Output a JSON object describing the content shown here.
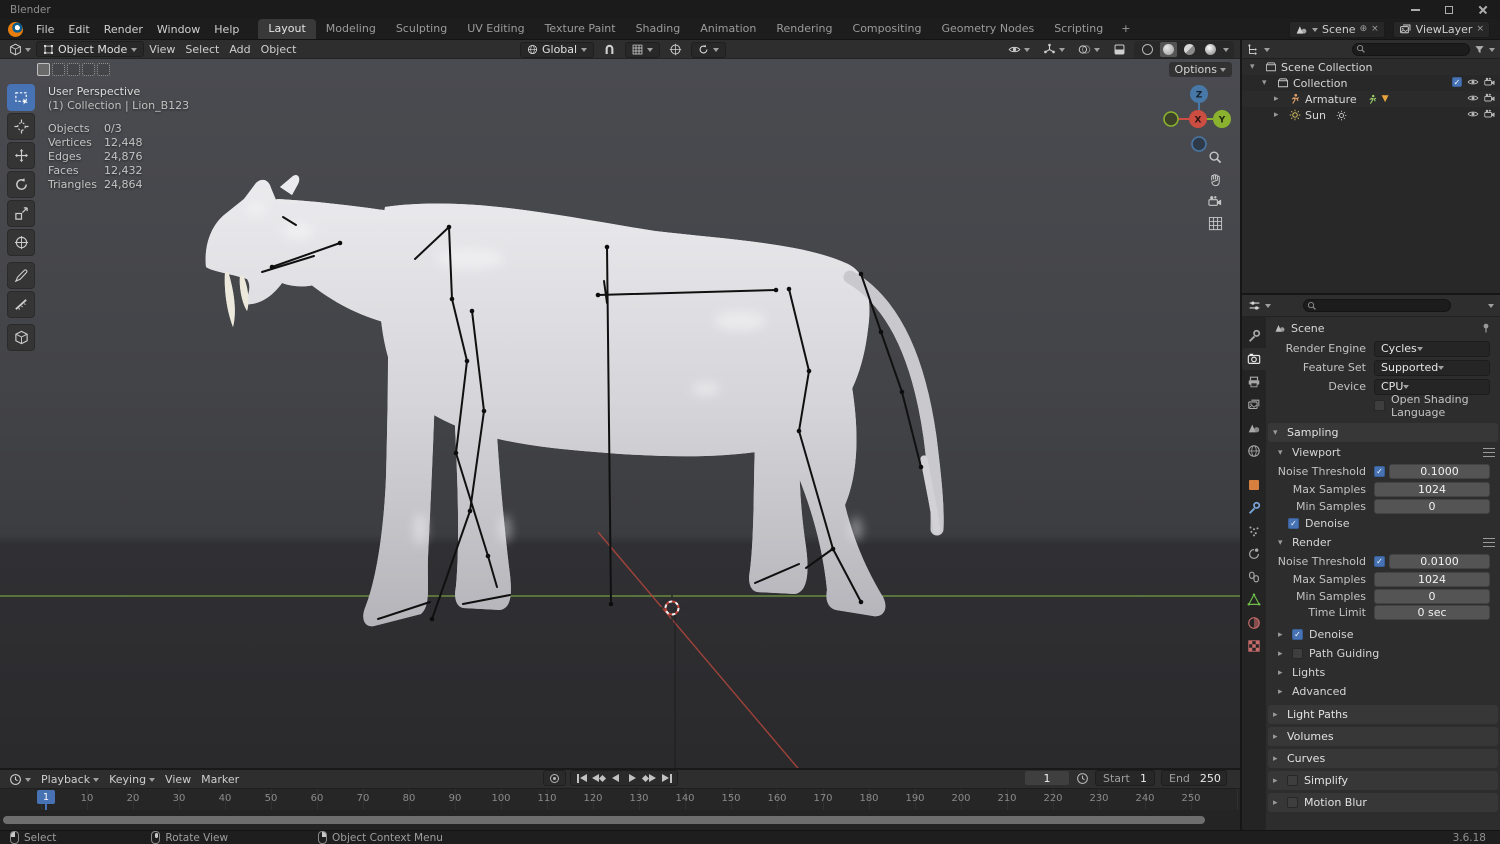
{
  "window": {
    "title": "Blender"
  },
  "menubar": {
    "menus": [
      "File",
      "Edit",
      "Render",
      "Window",
      "Help"
    ],
    "workspaces": [
      "Layout",
      "Modeling",
      "Sculpting",
      "UV Editing",
      "Texture Paint",
      "Shading",
      "Animation",
      "Rendering",
      "Compositing",
      "Geometry Nodes",
      "Scripting"
    ],
    "add_tab": "+",
    "scene": "Scene",
    "viewlayer": "ViewLayer"
  },
  "vp_header": {
    "mode": "Object Mode",
    "menus": [
      "View",
      "Select",
      "Add",
      "Object"
    ],
    "orientation": "Global",
    "options": "Options"
  },
  "viewport": {
    "title": "User Perspective",
    "subtitle": "(1) Collection | Lion_B123",
    "stats": [
      {
        "label": "Objects",
        "value": "0/3"
      },
      {
        "label": "Vertices",
        "value": "12,448"
      },
      {
        "label": "Edges",
        "value": "24,876"
      },
      {
        "label": "Faces",
        "value": "12,432"
      },
      {
        "label": "Triangles",
        "value": "24,864"
      }
    ],
    "axes": {
      "x": "X",
      "y": "Y",
      "z": "Z"
    }
  },
  "outliner": {
    "rows": [
      {
        "label": "Scene Collection"
      },
      {
        "label": "Collection"
      },
      {
        "label": "Armature"
      },
      {
        "label": "Sun"
      }
    ]
  },
  "properties": {
    "breadcrumb": "Scene",
    "render_engine_label": "Render Engine",
    "render_engine": "Cycles",
    "feature_set_label": "Feature Set",
    "feature_set": "Supported",
    "device_label": "Device",
    "device": "CPU",
    "osl_label": "Open Shading Language",
    "sampling": "Sampling",
    "viewport": "Viewport",
    "render": "Render",
    "noise_threshold": "Noise Threshold",
    "max_samples": "Max Samples",
    "min_samples": "Min Samples",
    "time_limit": "Time Limit",
    "denoise": "Denoise",
    "vp_noise": "0.1000",
    "vp_max": "1024",
    "vp_min": "0",
    "r_noise": "0.0100",
    "r_max": "1024",
    "r_min": "0",
    "r_time": "0 sec",
    "subpanels": [
      "Path Guiding",
      "Lights",
      "Advanced"
    ],
    "panels": [
      "Light Paths",
      "Volumes",
      "Curves",
      "Simplify",
      "Motion Blur"
    ]
  },
  "timeline": {
    "menus": [
      "Playback",
      "Keying",
      "View",
      "Marker"
    ],
    "frame": "1",
    "start_label": "Start",
    "start": "1",
    "end_label": "End",
    "end": "250",
    "ticks": [
      "10",
      "20",
      "30",
      "40",
      "50",
      "60",
      "70",
      "80",
      "90",
      "100",
      "110",
      "120",
      "130",
      "140",
      "150",
      "160",
      "170",
      "180",
      "190",
      "200",
      "210",
      "220",
      "230",
      "240",
      "250"
    ]
  },
  "statusbar": {
    "select": "Select",
    "rotate": "Rotate View",
    "context": "Object Context Menu",
    "version": "3.6.18"
  },
  "colors": {
    "accent": "#4772b3",
    "axis_x": "#cc4d42",
    "axis_y": "#8ab22e",
    "axis_z": "#4878a8"
  }
}
